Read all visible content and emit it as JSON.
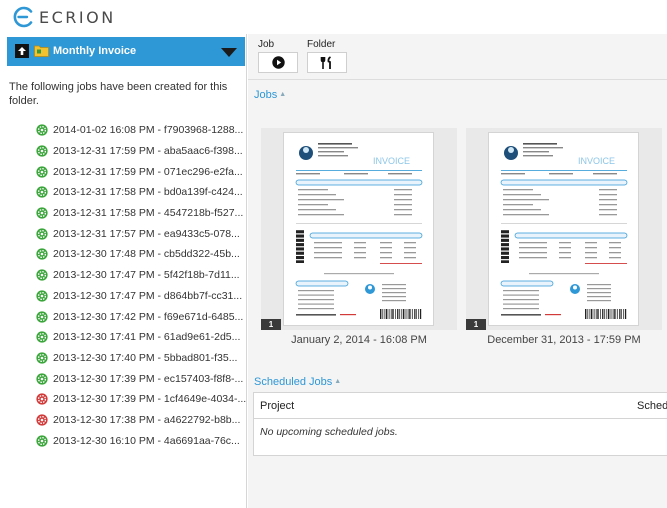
{
  "brand": {
    "name": "ECRION",
    "accent": "#2e97d6"
  },
  "sidebar": {
    "folder_title": "Monthly Invoice",
    "intro": "The following jobs have been created for this folder.",
    "jobs": [
      {
        "label": "2014-01-02 16:08 PM - f7903968-1288...",
        "status": "success"
      },
      {
        "label": "2013-12-31 17:59 PM - aba5aac6-f398...",
        "status": "success"
      },
      {
        "label": "2013-12-31 17:59 PM - 071ec296-e2fa...",
        "status": "success"
      },
      {
        "label": "2013-12-31 17:58 PM - bd0a139f-c424...",
        "status": "success"
      },
      {
        "label": "2013-12-31 17:58 PM - 4547218b-f527...",
        "status": "success"
      },
      {
        "label": "2013-12-31 17:57 PM - ea9433c5-078...",
        "status": "success"
      },
      {
        "label": "2013-12-30 17:48 PM - cb5dd322-45b...",
        "status": "success"
      },
      {
        "label": "2013-12-30 17:47 PM - 5f42f18b-7d11...",
        "status": "success"
      },
      {
        "label": "2013-12-30 17:47 PM - d864bb7f-cc31...",
        "status": "success"
      },
      {
        "label": "2013-12-30 17:42 PM - f69e671d-6485...",
        "status": "success"
      },
      {
        "label": "2013-12-30 17:41 PM - 61ad9e61-2d5...",
        "status": "success"
      },
      {
        "label": "2013-12-30 17:40 PM - 5bbad801-f35...",
        "status": "success"
      },
      {
        "label": "2013-12-30 17:39 PM - ec157403-f8f8-...",
        "status": "success"
      },
      {
        "label": "2013-12-30 17:39 PM - 1cf4649e-4034-...",
        "status": "error"
      },
      {
        "label": "2013-12-30 17:38 PM - a4622792-b8b...",
        "status": "error"
      },
      {
        "label": "2013-12-30 16:10 PM - 4a6691aa-76c...",
        "status": "success"
      }
    ]
  },
  "toolbar": {
    "job_label": "Job",
    "folder_label": "Folder",
    "job_icon": "play-icon",
    "folder_icon": "tools-icon"
  },
  "jobs_section": {
    "title": "Jobs",
    "thumbnails": [
      {
        "caption": "January 2, 2014 - 16:08 PM",
        "badge": "1"
      },
      {
        "caption": "December 31, 2013 - 17:59 PM",
        "badge": "1"
      }
    ]
  },
  "scheduled_section": {
    "title": "Scheduled Jobs",
    "columns": [
      "Project",
      "Schedu"
    ],
    "empty_text": "No upcoming scheduled jobs."
  },
  "invoice_preview": {
    "heading": "INVOICE"
  },
  "colors": {
    "success": "#3aa53a",
    "error": "#d23a3a",
    "sidebar_header": "#2e97d6"
  }
}
